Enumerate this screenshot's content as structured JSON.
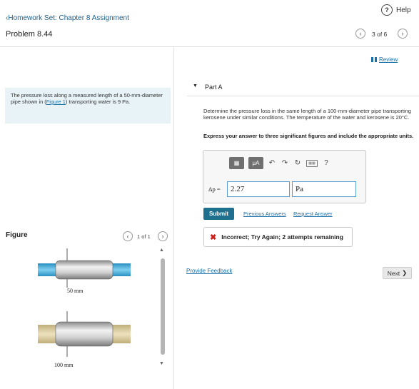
{
  "header": {
    "help_label": "Help",
    "back_link": "Homework Set: Chapter 8 Assignment",
    "problem_title": "Problem 8.44",
    "page_counter": "3 of 6"
  },
  "problem": {
    "text_before_link": "The pressure loss along a measured length of a 50-mm-diameter pipe shown in (",
    "figure_link": "Figure 1",
    "text_after_link": ") transporting water is 9 Pa."
  },
  "figure": {
    "label": "Figure",
    "counter": "1 of 1",
    "pipe1_label": "50 mm",
    "pipe2_label": "100 mm"
  },
  "review_link": "Review",
  "part": {
    "title": "Part A",
    "question": "Determine the pressure loss in the same length of a 100-mm-diameter pipe transporting kerosene under similar conditions. The temperature of the water and kerosene is 20°C.",
    "instruction": "Express your answer to three significant figures and include the appropriate units."
  },
  "answer": {
    "toolbar_templates": "▦",
    "toolbar_units": "μA",
    "toolbar_help": "?",
    "variable_label": "Δp =",
    "value": "2.27",
    "unit": "Pa"
  },
  "actions": {
    "submit": "Submit",
    "previous_answers": "Previous Answers",
    "request_answer": "Request Answer"
  },
  "feedback": {
    "message": "Incorrect; Try Again; 2 attempts remaining"
  },
  "footer": {
    "provide_feedback": "Provide Feedback",
    "next": "Next"
  },
  "colors": {
    "accent": "#1f6f8f",
    "link": "#1a6fa8",
    "error": "#d0201a",
    "water": "#3fa9d6",
    "kerosene": "#d8c89a"
  }
}
